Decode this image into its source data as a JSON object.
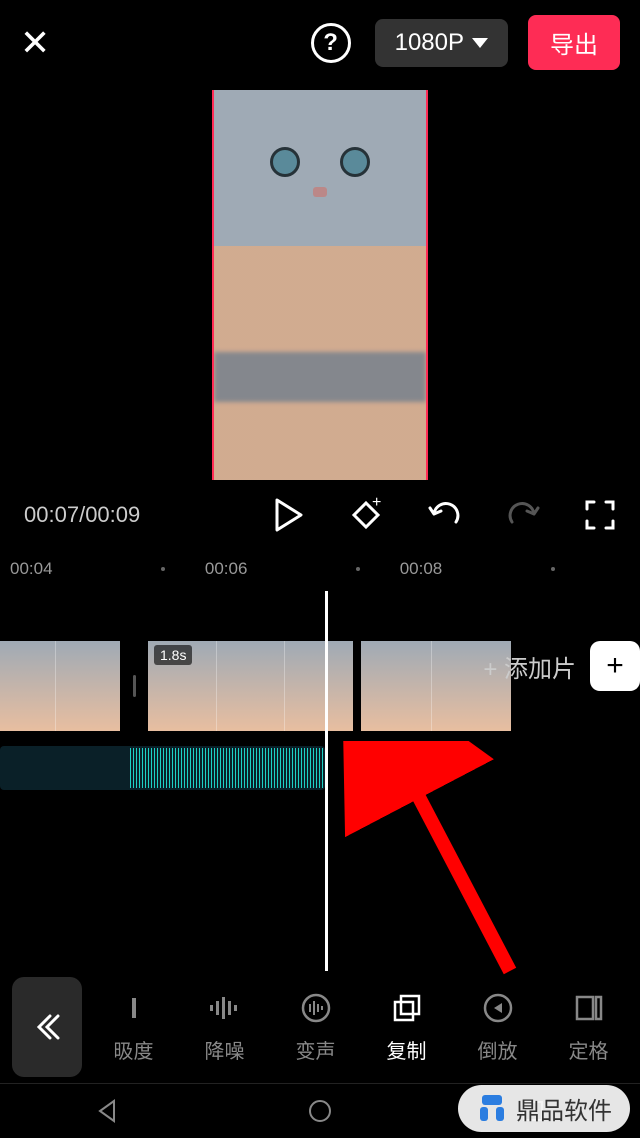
{
  "header": {
    "resolution": "1080P",
    "export": "导出"
  },
  "time": {
    "current": "00:07",
    "total": "00:09"
  },
  "ruler": {
    "t1": "00:04",
    "t2": "00:06",
    "t3": "00:08"
  },
  "clip": {
    "duration": "1.8s"
  },
  "add": {
    "label": "+ 添加片"
  },
  "tools": [
    {
      "id": "speed",
      "label": "昅度"
    },
    {
      "id": "denoise",
      "label": "降噪"
    },
    {
      "id": "voice",
      "label": "变声"
    },
    {
      "id": "copy",
      "label": "复制"
    },
    {
      "id": "reverse",
      "label": "倒放"
    },
    {
      "id": "freeze",
      "label": "定格"
    }
  ],
  "watermark": "鼎品软件"
}
